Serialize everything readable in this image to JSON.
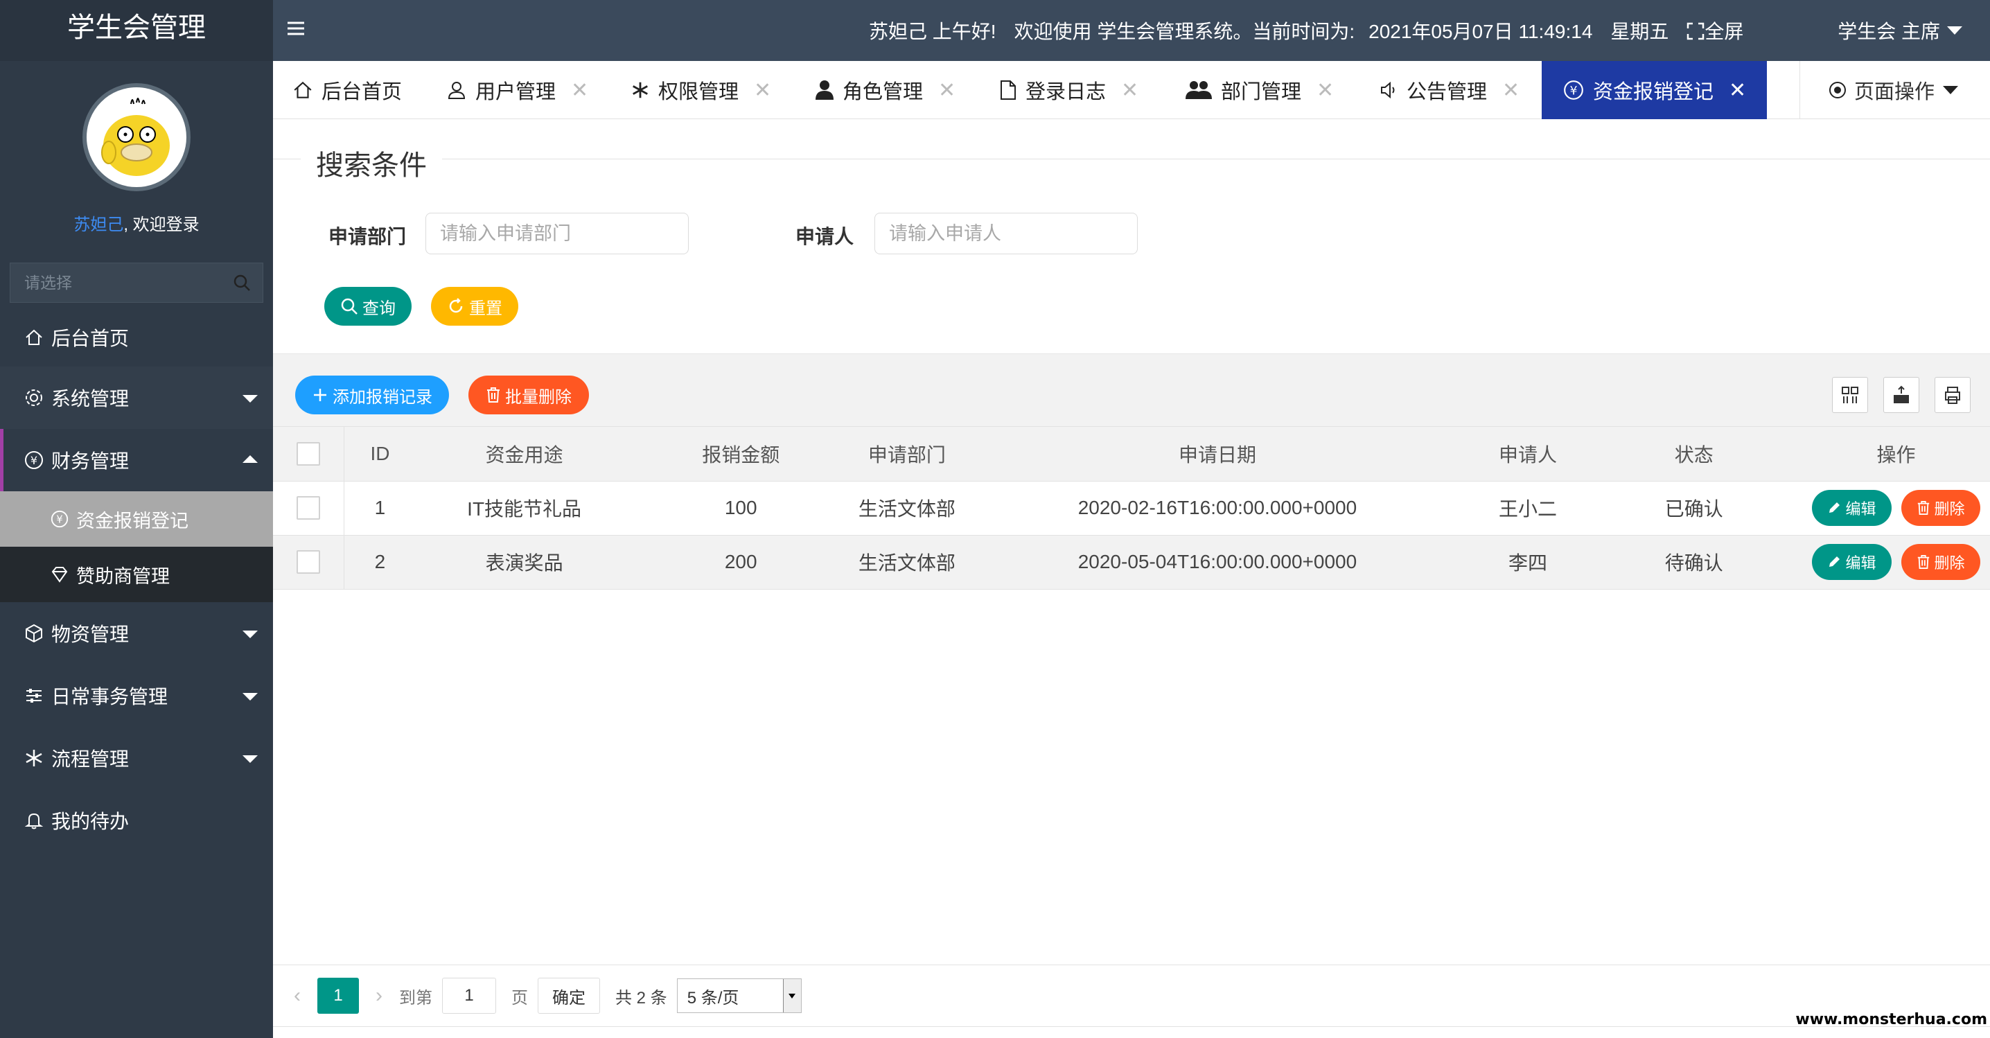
{
  "app": {
    "title": "学生会管理",
    "user_name": "苏妲己",
    "welcome_suffix": ", 欢迎登录",
    "side_search_placeholder": "请选择"
  },
  "sidebar": {
    "items": [
      {
        "label": "后台首页",
        "icon": "home-icon"
      },
      {
        "label": "系统管理",
        "icon": "gear-icon"
      },
      {
        "label": "财务管理",
        "icon": "yen-circle-icon",
        "expanded": true
      },
      {
        "label": "物资管理",
        "icon": "box-icon"
      },
      {
        "label": "日常事务管理",
        "icon": "sliders-icon"
      },
      {
        "label": "流程管理",
        "icon": "snowflake-icon"
      },
      {
        "label": "我的待办",
        "icon": "bell-icon"
      }
    ],
    "finance_sub": [
      {
        "label": "资金报销登记",
        "icon": "yen-circle-icon",
        "selected": true
      },
      {
        "label": "赞助商管理",
        "icon": "diamond-icon"
      }
    ]
  },
  "header": {
    "greeting": "苏妲己 上午好!",
    "welcome": "欢迎使用 学生会管理系统。当前时间为:",
    "datetime": "2021年05月07日 11:49:14",
    "weekday": "星期五",
    "fullscreen": "全屏",
    "role": "学生会 主席"
  },
  "tabs": [
    {
      "label": "后台首页",
      "icon": "home-icon",
      "closable": false
    },
    {
      "label": "用户管理",
      "icon": "user-icon",
      "closable": true
    },
    {
      "label": "权限管理",
      "icon": "snowflake-icon",
      "closable": true
    },
    {
      "label": "角色管理",
      "icon": "person-icon",
      "closable": true
    },
    {
      "label": "登录日志",
      "icon": "file-icon",
      "closable": true
    },
    {
      "label": "部门管理",
      "icon": "group-icon",
      "closable": true
    },
    {
      "label": "公告管理",
      "icon": "speaker-icon",
      "closable": true
    },
    {
      "label": "资金报销登记",
      "icon": "yen-circle-icon",
      "closable": true,
      "active": true
    }
  ],
  "page_ops": "页面操作",
  "search": {
    "legend": "搜索条件",
    "dept_label": "申请部门",
    "dept_placeholder": "请输入申请部门",
    "applicant_label": "申请人",
    "applicant_placeholder": "请输入申请人",
    "query_btn": "查询",
    "reset_btn": "重置"
  },
  "toolbar": {
    "add_btn": "添加报销记录",
    "batch_delete_btn": "批量删除"
  },
  "table": {
    "columns": [
      "ID",
      "资金用途",
      "报销金额",
      "申请部门",
      "申请日期",
      "申请人",
      "状态",
      "操作"
    ],
    "rows": [
      {
        "id": "1",
        "purpose": "IT技能节礼品",
        "amount": "100",
        "dept": "生活文体部",
        "date": "2020-02-16T16:00:00.000+0000",
        "applicant": "王小二",
        "status": "已确认"
      },
      {
        "id": "2",
        "purpose": "表演奖品",
        "amount": "200",
        "dept": "生活文体部",
        "date": "2020-05-04T16:00:00.000+0000",
        "applicant": "李四",
        "status": "待确认"
      }
    ],
    "edit_label": "编辑",
    "delete_label": "删除"
  },
  "pager": {
    "current": "1",
    "goto_prefix": "到第",
    "goto_value": "1",
    "page_suffix": "页",
    "confirm": "确定",
    "total": "共 2 条",
    "page_size": "5 条/页"
  },
  "watermark": "www.monsterhua.com",
  "colors": {
    "sidebar": "#2f3a47",
    "header": "#3b4a5c",
    "active_tab": "#1e3aa3",
    "green": "#009688",
    "orange": "#ff5722",
    "blue": "#1e9fff",
    "yellow": "#ffb800"
  }
}
